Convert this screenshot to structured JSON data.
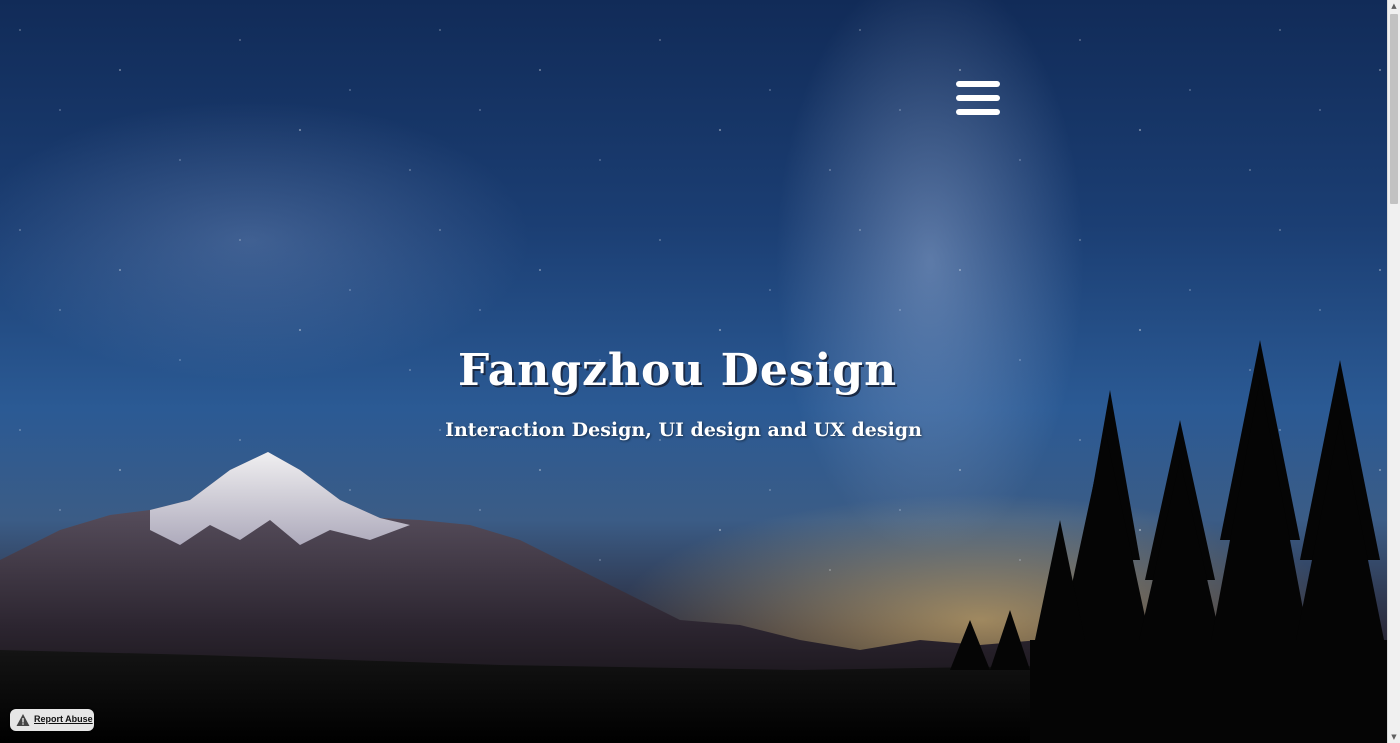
{
  "hero": {
    "title": "Fangzhou Design",
    "subtitle": "Interaction Design, UI design and UX design"
  },
  "menu": {
    "icon": "hamburger-menu-icon"
  },
  "report_abuse": {
    "label": "Report Abuse",
    "icon": "warning-icon"
  },
  "colors": {
    "text": "#ffffff",
    "sky_top": "#112b58",
    "sky_mid": "#2b5a94",
    "horizon_glow": "#ffd27a",
    "ground": "#050505"
  },
  "scrollbar": {
    "up_icon": "scroll-up-arrow-icon",
    "down_icon": "scroll-down-arrow-icon"
  }
}
